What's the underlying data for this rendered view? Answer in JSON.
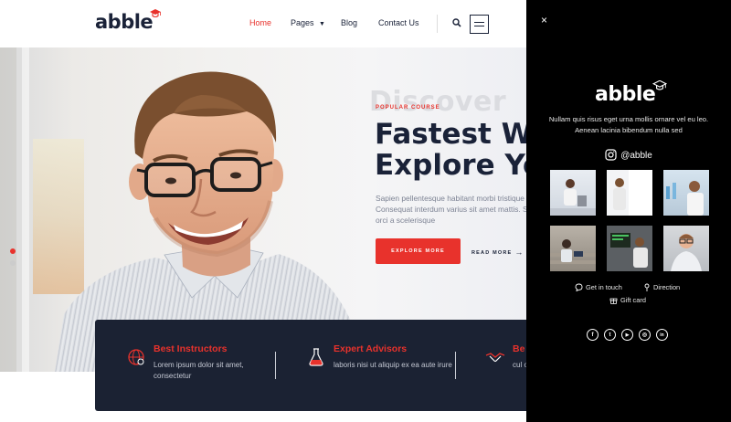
{
  "header": {
    "logo": "abble",
    "nav": [
      {
        "label": "Home",
        "active": true
      },
      {
        "label": "Pages",
        "dropdown": true
      },
      {
        "label": "Blog"
      },
      {
        "label": "Contact Us"
      }
    ],
    "icons": [
      "search-icon",
      "hamburger-menu-icon"
    ]
  },
  "hero": {
    "ghost_word": "Discover",
    "kicker": "POPULAR COURSE",
    "title_line1": "Fastest Wa",
    "title_line2": "Explore You",
    "description": "Sapien pellentesque habitant morbi tristique s Consequat interdum varius sit amet mattis. Sc sagittis orci a scelerisque",
    "explore_button": "EXPLORE MORE",
    "read_more": "READ MORE",
    "slider_dots": 2,
    "active_dot": 0
  },
  "features": [
    {
      "icon": "instructor-globe-icon",
      "title": "Best Instructors",
      "description": "Lorem ipsum dolor sit amet, consectetur"
    },
    {
      "icon": "flask-icon",
      "title": "Expert Advisors",
      "description": "laboris nisi ut aliquip ex ea aute irure"
    },
    {
      "icon": "handshake-icon",
      "title": "Be",
      "description": "cul ope"
    }
  ],
  "panel": {
    "close": "×",
    "logo": "abble",
    "description": "Nullam quis risus eget urna mollis ornare vel eu leo. Aenean lacinia bibendum nulla sed",
    "instagram_handle": "@abble",
    "gallery_count": 6,
    "links": [
      {
        "icon": "chat-icon",
        "label": "Get in touch"
      },
      {
        "icon": "map-pin-icon",
        "label": "Direction"
      },
      {
        "icon": "gift-icon",
        "label": "Gift card"
      }
    ],
    "socials": [
      {
        "icon": "facebook-icon",
        "glyph": "f"
      },
      {
        "icon": "twitter-icon",
        "glyph": "t"
      },
      {
        "icon": "youtube-icon",
        "glyph": "▶"
      },
      {
        "icon": "instagram-icon",
        "glyph": "◎"
      },
      {
        "icon": "linkedin-icon",
        "glyph": "in"
      }
    ]
  },
  "colors": {
    "accent": "#e8322c",
    "navy": "#1b2233",
    "panel_bg": "#000000"
  }
}
